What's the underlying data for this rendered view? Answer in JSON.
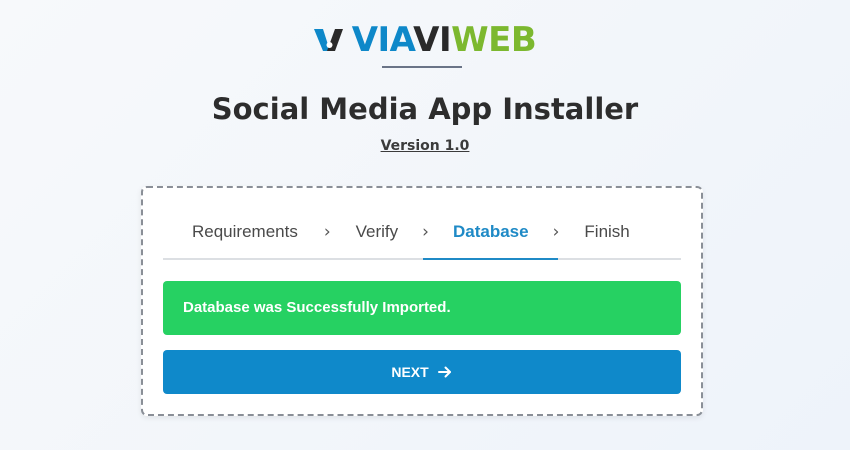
{
  "brand": {
    "part_via": "VIA",
    "part_vi": "VI",
    "part_web": "WEB",
    "colors": {
      "blue": "#0e88c9",
      "dark": "#2a2a2a",
      "green": "#7cb82f"
    }
  },
  "header": {
    "title": "Social Media App Installer",
    "version": "Version 1.0"
  },
  "steps": [
    {
      "label": "Requirements",
      "active": false
    },
    {
      "label": "Verify",
      "active": false
    },
    {
      "label": "Database",
      "active": true
    },
    {
      "label": "Finish",
      "active": false
    }
  ],
  "step_separator_icon": "chevron-right-icon",
  "alert": {
    "message": "Database was Successfully Imported.",
    "color": "#26d162"
  },
  "next_button": {
    "label": "NEXT",
    "icon": "arrow-right-icon",
    "color": "#0f89ca"
  },
  "accent_color": "#1f8ac6"
}
